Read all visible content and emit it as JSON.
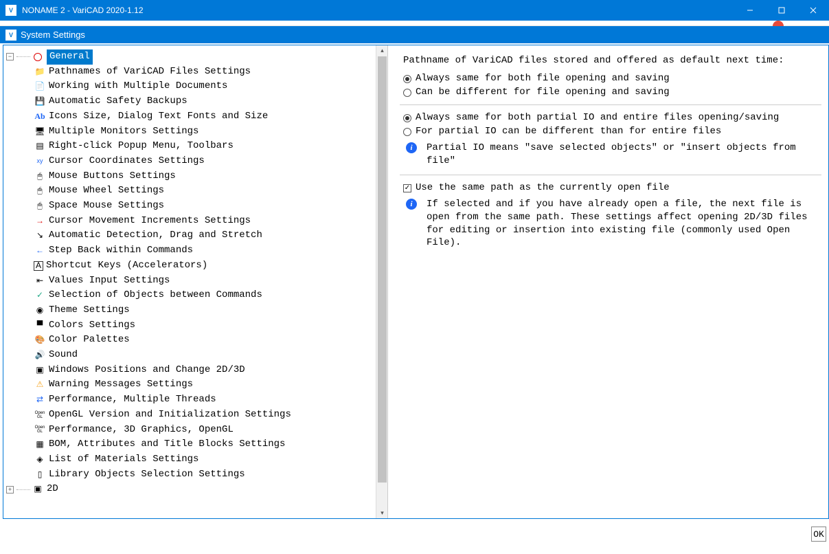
{
  "window": {
    "title": "NONAME 2 - VariCAD 2020-1.12",
    "dialog_title": "System Settings"
  },
  "tree": {
    "root_general": "General",
    "items": [
      {
        "label": "Pathnames of VariCAD Files Settings",
        "icon": "📁",
        "icon_name": "folder-icon"
      },
      {
        "label": "Working with Multiple Documents",
        "icon": "📄",
        "icon_name": "documents-icon"
      },
      {
        "label": "Automatic Safety Backups",
        "icon": "💾",
        "icon_name": "save-icon"
      },
      {
        "label": "Icons Size, Dialog Text Fonts and Size",
        "icon": "Ab",
        "icon_name": "font-icon",
        "icon_color": "#1e66f5"
      },
      {
        "label": "Multiple Monitors Settings",
        "icon": "🖥",
        "icon_name": "monitor-icon"
      },
      {
        "label": "Right-click Popup Menu, Toolbars",
        "icon": "▤",
        "icon_name": "menu-icon"
      },
      {
        "label": "Cursor Coordinates Settings",
        "icon": "xy",
        "icon_name": "xy-icon",
        "icon_color": "#1e66f5",
        "icon_size": "9px"
      },
      {
        "label": "Mouse Buttons Settings",
        "icon": "🖱",
        "icon_name": "mouse-icon"
      },
      {
        "label": "Mouse Wheel Settings",
        "icon": "🖱",
        "icon_name": "mouse-wheel-icon"
      },
      {
        "label": "Space Mouse Settings",
        "icon": "🖱",
        "icon_name": "space-mouse-icon"
      },
      {
        "label": "Cursor Movement Increments Settings",
        "icon": "→",
        "icon_name": "arrow-right-icon",
        "icon_color": "#d00"
      },
      {
        "label": "Automatic Detection, Drag and Stretch",
        "icon": "↘",
        "icon_name": "drag-icon"
      },
      {
        "label": "Step Back within Commands",
        "icon": "←",
        "icon_name": "arrow-left-icon",
        "icon_color": "#1e66f5"
      },
      {
        "label": "Shortcut Keys (Accelerators)",
        "icon": "A",
        "icon_name": "keyboard-a-icon",
        "icon_border": true
      },
      {
        "label": "Values Input Settings",
        "icon": "⇤",
        "icon_name": "input-icon"
      },
      {
        "label": "Selection of Objects between Commands",
        "icon": "✓",
        "icon_name": "check-icon",
        "icon_color": "#2a8"
      },
      {
        "label": "Theme Settings",
        "icon": "◉",
        "icon_name": "theme-icon"
      },
      {
        "label": "Colors Settings",
        "icon": "▀",
        "icon_name": "colors-icon"
      },
      {
        "label": "Color Palettes",
        "icon": "🎨",
        "icon_name": "palette-icon"
      },
      {
        "label": "Sound",
        "icon": "🔊",
        "icon_name": "sound-icon",
        "icon_color": "#1e66f5"
      },
      {
        "label": "Windows Positions and Change 2D/3D",
        "icon": "▣",
        "icon_name": "windows-icon"
      },
      {
        "label": "Warning Messages Settings",
        "icon": "⚠",
        "icon_name": "warning-icon",
        "icon_color": "#f5a623"
      },
      {
        "label": "Performance, Multiple Threads",
        "icon": "⇄",
        "icon_name": "threads-icon",
        "icon_color": "#1e66f5"
      },
      {
        "label": "OpenGL Version and Initialization Settings",
        "icon": "Open\nGL",
        "icon_name": "opengl-icon",
        "icon_size": "6px"
      },
      {
        "label": "Performance, 3D Graphics, OpenGL",
        "icon": "Open\nGL",
        "icon_name": "opengl-perf-icon",
        "icon_size": "6px"
      },
      {
        "label": "BOM, Attributes and Title Blocks Settings",
        "icon": "▦",
        "icon_name": "bom-icon"
      },
      {
        "label": "List of Materials Settings",
        "icon": "◈",
        "icon_name": "materials-icon"
      },
      {
        "label": "Library Objects Selection Settings",
        "icon": "▯",
        "icon_name": "library-icon"
      }
    ],
    "root_2d": "2D"
  },
  "right": {
    "heading": "Pathname of VariCAD files stored and offered as default next time:",
    "g1_opt1": "Always same for both file opening and saving",
    "g1_opt2": "Can be different for file opening and saving",
    "g2_opt1": "Always same for both partial IO and entire files opening/saving",
    "g2_opt2": "For partial IO can be different than for entire files",
    "info1": "Partial IO means \"save selected objects\" or \"insert objects from file\"",
    "check1": "Use the same path as the currently open file",
    "info2": "If selected and if you have already open a file, the next file is open from the same path. These settings affect opening 2D/3D files for editing or insertion into existing file (commonly used Open File).",
    "ok": "OK"
  }
}
